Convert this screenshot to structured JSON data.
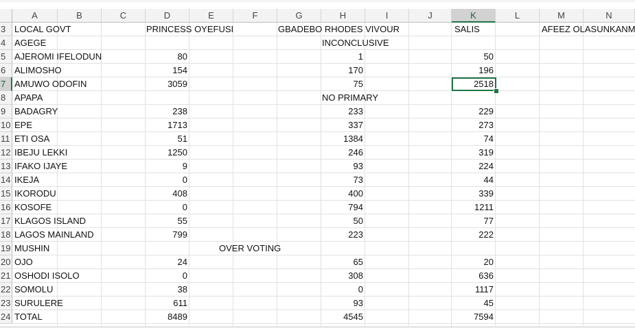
{
  "columns": [
    "A",
    "B",
    "C",
    "D",
    "E",
    "F",
    "G",
    "H",
    "I",
    "J",
    "K",
    "L",
    "M",
    "N"
  ],
  "selected_column": "K",
  "selected_row": "7",
  "rows": [
    {
      "num": "3",
      "a": "LOCAL GOVT",
      "d": "",
      "h": "",
      "k": ""
    },
    {
      "num": "4",
      "a": "AGEGE",
      "d": "",
      "h": "",
      "k": ""
    },
    {
      "num": "5",
      "a": "AJEROMI IFELODUN",
      "d": "80",
      "h": "1",
      "k": "50"
    },
    {
      "num": "6",
      "a": "ALIMOSHO",
      "d": "154",
      "h": "170",
      "k": "196"
    },
    {
      "num": "7",
      "a": "AMUWO ODOFIN",
      "d": "3059",
      "h": "75",
      "k": "2518"
    },
    {
      "num": "8",
      "a": "APAPA",
      "d": "",
      "h": "",
      "k": ""
    },
    {
      "num": "9",
      "a": "BADAGRY",
      "d": "238",
      "h": "233",
      "k": "229"
    },
    {
      "num": "10",
      "a": "EPE",
      "d": "1713",
      "h": "337",
      "k": "273"
    },
    {
      "num": "11",
      "a": "ETI OSA",
      "d": "51",
      "h": "1384",
      "k": "74"
    },
    {
      "num": "12",
      "a": "IBEJU LEKKI",
      "d": "1250",
      "h": "246",
      "k": "319"
    },
    {
      "num": "13",
      "a": "IFAKO IJAYE",
      "d": "9",
      "h": "93",
      "k": "224"
    },
    {
      "num": "14",
      "a": "IKEJA",
      "d": "0",
      "h": "73",
      "k": "44"
    },
    {
      "num": "15",
      "a": "IKORODU",
      "d": "408",
      "h": "400",
      "k": "339"
    },
    {
      "num": "16",
      "a": "KOSOFE",
      "d": "0",
      "h": "794",
      "k": "1211"
    },
    {
      "num": "17",
      "a": "KLAGOS ISLAND",
      "d": "55",
      "h": "50",
      "k": "77"
    },
    {
      "num": "18",
      "a": "LAGOS MAINLAND",
      "d": "799",
      "h": "223",
      "k": "222"
    },
    {
      "num": "19",
      "a": "MUSHIN",
      "d": "",
      "h": "",
      "k": ""
    },
    {
      "num": "20",
      "a": "OJO",
      "d": "24",
      "h": "65",
      "k": "20"
    },
    {
      "num": "21",
      "a": "OSHODI ISOLO",
      "d": "0",
      "h": "308",
      "k": "636"
    },
    {
      "num": "22",
      "a": "SOMOLU",
      "d": "38",
      "h": "0",
      "k": "1117"
    },
    {
      "num": "23",
      "a": "SURULERE",
      "d": "611",
      "h": "93",
      "k": "45"
    },
    {
      "num": "24",
      "a": "TOTAL",
      "d": "8489",
      "h": "4545",
      "k": "7594"
    }
  ],
  "header_labels": {
    "princess": "PRINCESS OYEFUSI",
    "gbadebo": "GBADEBO RHODES VIVOUR",
    "salis": "SALIS",
    "afeez": "AFEEZ OLASUNKANMI"
  },
  "notes": {
    "inconclusive": "INCONCLUSIVE",
    "no_primary": "NO PRIMARY",
    "over_voting": "OVER VOTING"
  },
  "colors": {
    "selection": "#217346",
    "header_bg": "#f3f3f3",
    "gridline": "#e1e1e1"
  }
}
